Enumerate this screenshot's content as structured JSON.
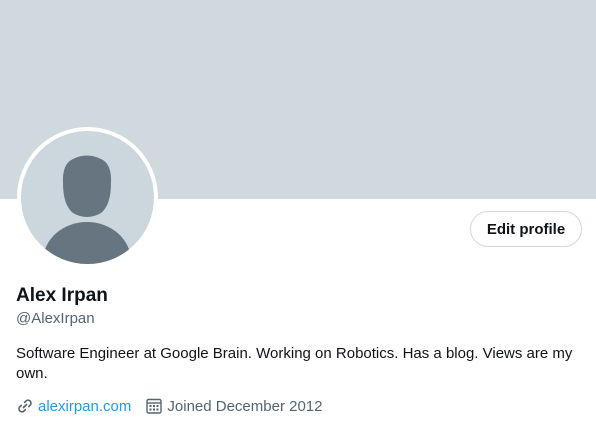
{
  "profile": {
    "name": "Alex Irpan",
    "handle": "@AlexIrpan",
    "bio": "Software Engineer at Google Brain. Working on Robotics. Has a blog. Views are my own.",
    "website": "alexirpan.com",
    "joined": "Joined December 2012"
  },
  "actions": {
    "edit_profile_label": "Edit profile"
  },
  "icons": {
    "website": "link-icon",
    "joined": "calendar-icon",
    "avatar": "default-avatar-silhouette"
  },
  "colors": {
    "banner": "#cfd9de",
    "avatar_bg": "#ccd6dd",
    "avatar_silhouette": "#66757f",
    "link": "#1d9bf0",
    "secondary_text": "#536471",
    "primary_text": "#0f1419"
  }
}
